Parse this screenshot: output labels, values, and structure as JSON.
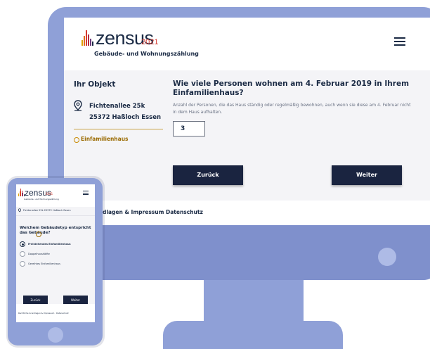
{
  "desktop": {
    "logo_word": "zensus",
    "logo_year": "2021",
    "logo_subtitle": "Gebäude- und Wohnungszählung",
    "menu_icon": "hamburger-menu-icon",
    "object_heading": "Ihr Objekt",
    "address_line1": "Fichtenallee 25k",
    "address_line2": "25372 Haßloch Essen",
    "building_type": "Einfamilienhaus",
    "question": "Wie viele Personen wohnen am 4. Februar 2019 in Ihrem Einfamilienhaus?",
    "help_text": "Anzahl der Personen, die das Haus ständig oder regelmäßig bewohnen, auch wenn sie diese am 4. Februar nicht in dem Haus aufhalten.",
    "answer_value": "3",
    "back_label": "Zurück",
    "next_label": "Weiter",
    "footer_links": [
      "dlagen & Impressum",
      "Datenschutz"
    ]
  },
  "phone": {
    "logo_word": "zensus",
    "logo_year": "2021",
    "logo_subtitle": "Gebäude- und Wohnungszählung",
    "address": "Fichtenallee 25k 25372 Haßloch Essen",
    "question": "Welchem Gebäudetyp entspricht das Gebäude?",
    "options": [
      {
        "label": "Freistehendes Einfamilienhaus",
        "selected": true
      },
      {
        "label": "Doppelhaushälfte",
        "selected": false
      },
      {
        "label": "Gereihtes Einfamilienhaus",
        "selected": false
      }
    ],
    "back_label": "Zurück",
    "next_label": "Weiter",
    "footer_links": [
      "Rechtliche Grundlagen & Impressum",
      "Datenschutz"
    ]
  },
  "colors": {
    "device_frame": "#8fa0d7",
    "button_bg": "#1a2440",
    "text_primary": "#1a2a44",
    "accent_gold": "#c9a34a",
    "logo_red": "#d63a2f"
  }
}
